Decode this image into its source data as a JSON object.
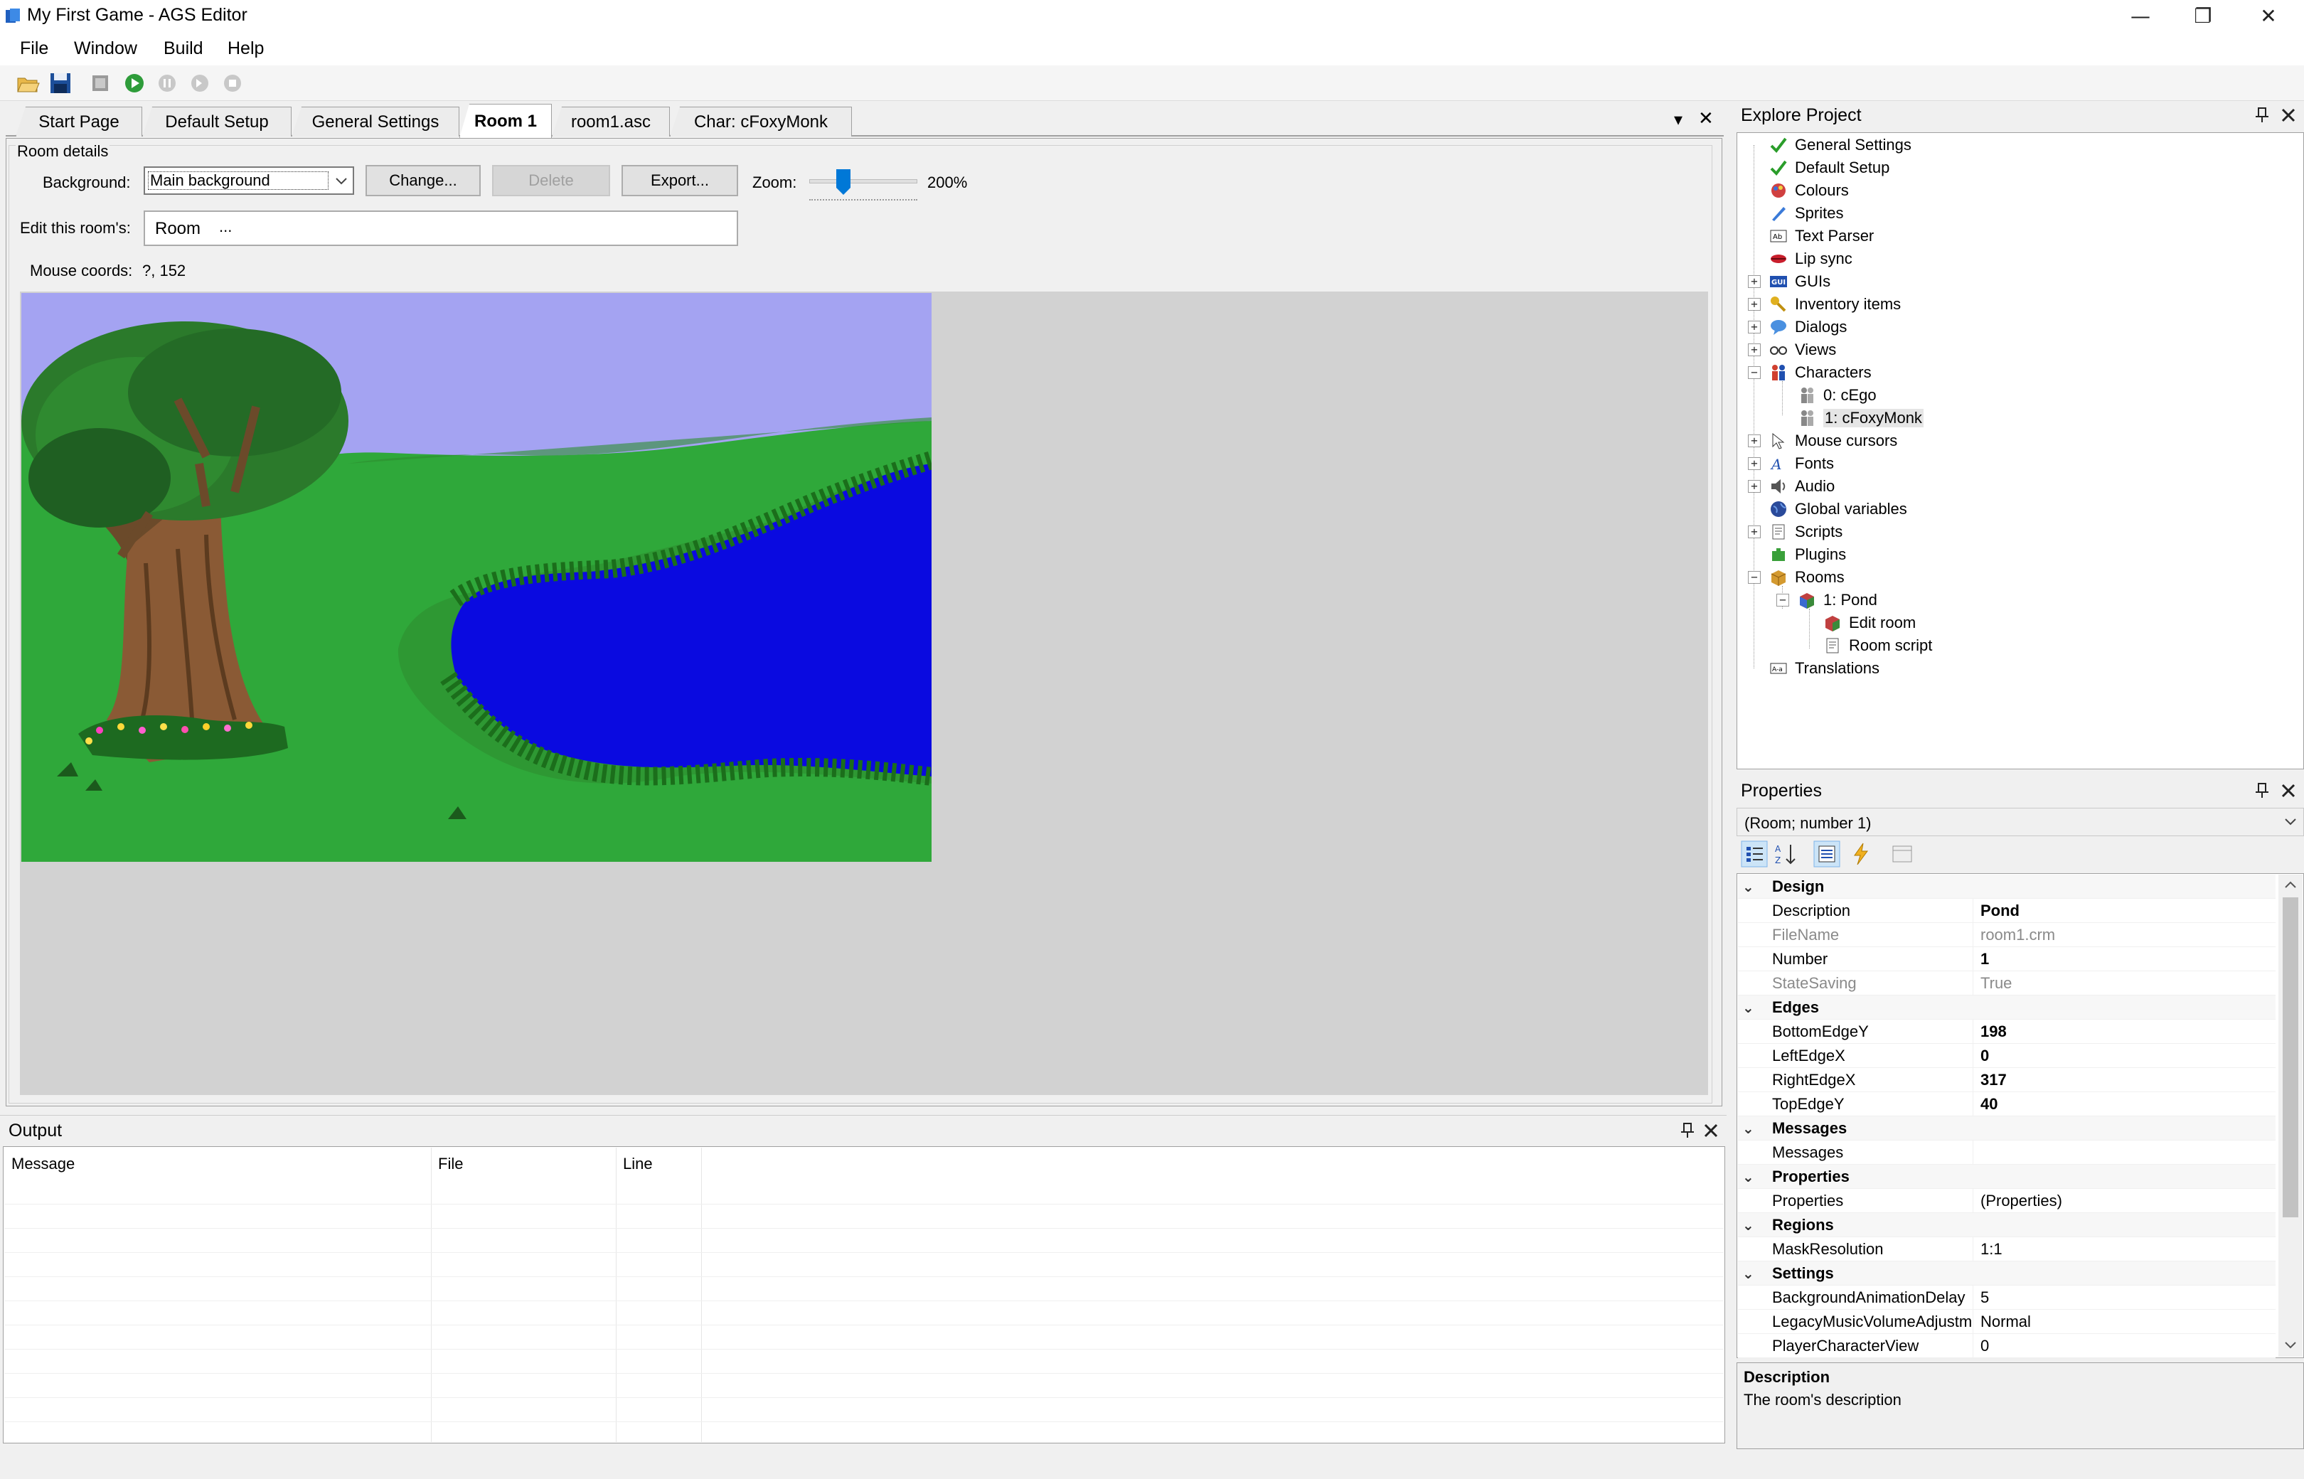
{
  "window": {
    "title": "My First Game - AGS Editor",
    "icon": "ags-app-icon",
    "minimize": "—",
    "restore": "❐",
    "close": "✕"
  },
  "menu": [
    "File",
    "Window",
    "Build",
    "Help"
  ],
  "toolbar": [
    "open-icon",
    "save-icon",
    "build-icon",
    "run-icon",
    "pause-icon",
    "step-icon",
    "stop-icon"
  ],
  "tabs": [
    "Start Page",
    "Default Setup",
    "General Settings",
    "Room 1",
    "room1.asc",
    "Char: cFoxyMonk"
  ],
  "tab_controls": {
    "dropdown": "▾",
    "close": "✕"
  },
  "room": {
    "group_label": "Room details",
    "background_label": "Background:",
    "background_value": "Main background",
    "change_button": "Change...",
    "delete_button": "Delete",
    "export_button": "Export...",
    "zoom_label": "Zoom:",
    "zoom_value": "200%",
    "edit_label": "Edit this room's:",
    "edit_value": "Room",
    "edit_more": "...",
    "mouse_coords_label": "Mouse coords:",
    "mouse_coords_value": "?, 152"
  },
  "output": {
    "title": "Output",
    "columns": [
      "Message",
      "File",
      "Line"
    ]
  },
  "explore": {
    "title": "Explore Project",
    "items": [
      {
        "label": "General Settings",
        "icon": "checkmark-icon"
      },
      {
        "label": "Default Setup",
        "icon": "checkmark-icon"
      },
      {
        "label": "Colours",
        "icon": "palette-icon"
      },
      {
        "label": "Sprites",
        "icon": "sprite-icon"
      },
      {
        "label": "Text Parser",
        "icon": "text-parser-icon"
      },
      {
        "label": "Lip sync",
        "icon": "lips-icon"
      },
      {
        "label": "GUIs",
        "icon": "gui-icon"
      },
      {
        "label": "Inventory items",
        "icon": "inventory-icon"
      },
      {
        "label": "Dialogs",
        "icon": "dialog-icon"
      },
      {
        "label": "Views",
        "icon": "views-icon"
      },
      {
        "label": "Characters",
        "icon": "characters-icon"
      },
      {
        "label": "0: cEgo",
        "icon": "character-icon"
      },
      {
        "label": "1: cFoxyMonk",
        "icon": "character-icon"
      },
      {
        "label": "Mouse cursors",
        "icon": "cursor-icon"
      },
      {
        "label": "Fonts",
        "icon": "font-icon"
      },
      {
        "label": "Audio",
        "icon": "audio-icon"
      },
      {
        "label": "Global variables",
        "icon": "globe-icon"
      },
      {
        "label": "Scripts",
        "icon": "script-icon"
      },
      {
        "label": "Plugins",
        "icon": "plugin-icon"
      },
      {
        "label": "Rooms",
        "icon": "rooms-icon"
      },
      {
        "label": "1: Pond",
        "icon": "room-icon"
      },
      {
        "label": "Edit room",
        "icon": "edit-room-icon"
      },
      {
        "label": "Room script",
        "icon": "room-script-icon"
      },
      {
        "label": "Translations",
        "icon": "translation-icon"
      }
    ]
  },
  "properties": {
    "title": "Properties",
    "selector": "(Room; number 1)",
    "rows": [
      {
        "type": "cat",
        "name": "Design"
      },
      {
        "name": "Description",
        "value": "Pond",
        "style": "bold"
      },
      {
        "name": "FileName",
        "value": "room1.crm",
        "style": "gray"
      },
      {
        "name": "Number",
        "value": "1",
        "style": "bold"
      },
      {
        "name": "StateSaving",
        "value": "True",
        "style": "gray"
      },
      {
        "type": "cat",
        "name": "Edges"
      },
      {
        "name": "BottomEdgeY",
        "value": "198",
        "style": "bold"
      },
      {
        "name": "LeftEdgeX",
        "value": "0",
        "style": "bold"
      },
      {
        "name": "RightEdgeX",
        "value": "317",
        "style": "bold"
      },
      {
        "name": "TopEdgeY",
        "value": "40",
        "style": "bold"
      },
      {
        "type": "cat",
        "name": "Messages"
      },
      {
        "name": "Messages",
        "value": ""
      },
      {
        "type": "cat",
        "name": "Properties"
      },
      {
        "name": "Properties",
        "value": "(Properties)"
      },
      {
        "type": "cat",
        "name": "Regions"
      },
      {
        "name": "MaskResolution",
        "value": "1:1"
      },
      {
        "type": "cat",
        "name": "Settings"
      },
      {
        "name": "BackgroundAnimationDelay",
        "value": "5"
      },
      {
        "name": "LegacyMusicVolumeAdjustment",
        "value": "Normal"
      },
      {
        "name": "PlayerCharacterView",
        "value": "0"
      }
    ],
    "description_title": "Description",
    "description_text": "The room's description"
  }
}
